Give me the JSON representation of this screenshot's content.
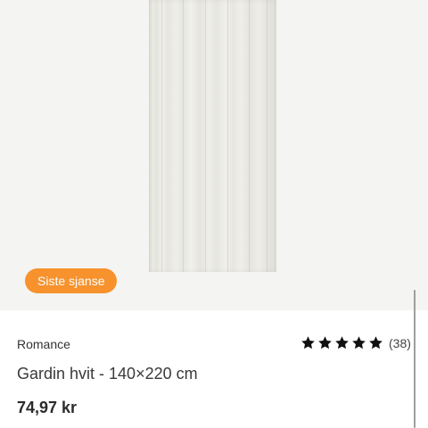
{
  "product": {
    "badge": "Siste sjanse",
    "brand": "Romance",
    "title": "Gardin hvit - 140×220 cm",
    "price": "74,97 kr",
    "rating": {
      "stars": 5,
      "count_label": "(38)",
      "star_icon": "star-icon",
      "star_color": "#111111"
    },
    "image_icon": "curtain-image"
  },
  "colors": {
    "badge_bg": "#f7922d",
    "image_bg": "#f4f4f3"
  }
}
